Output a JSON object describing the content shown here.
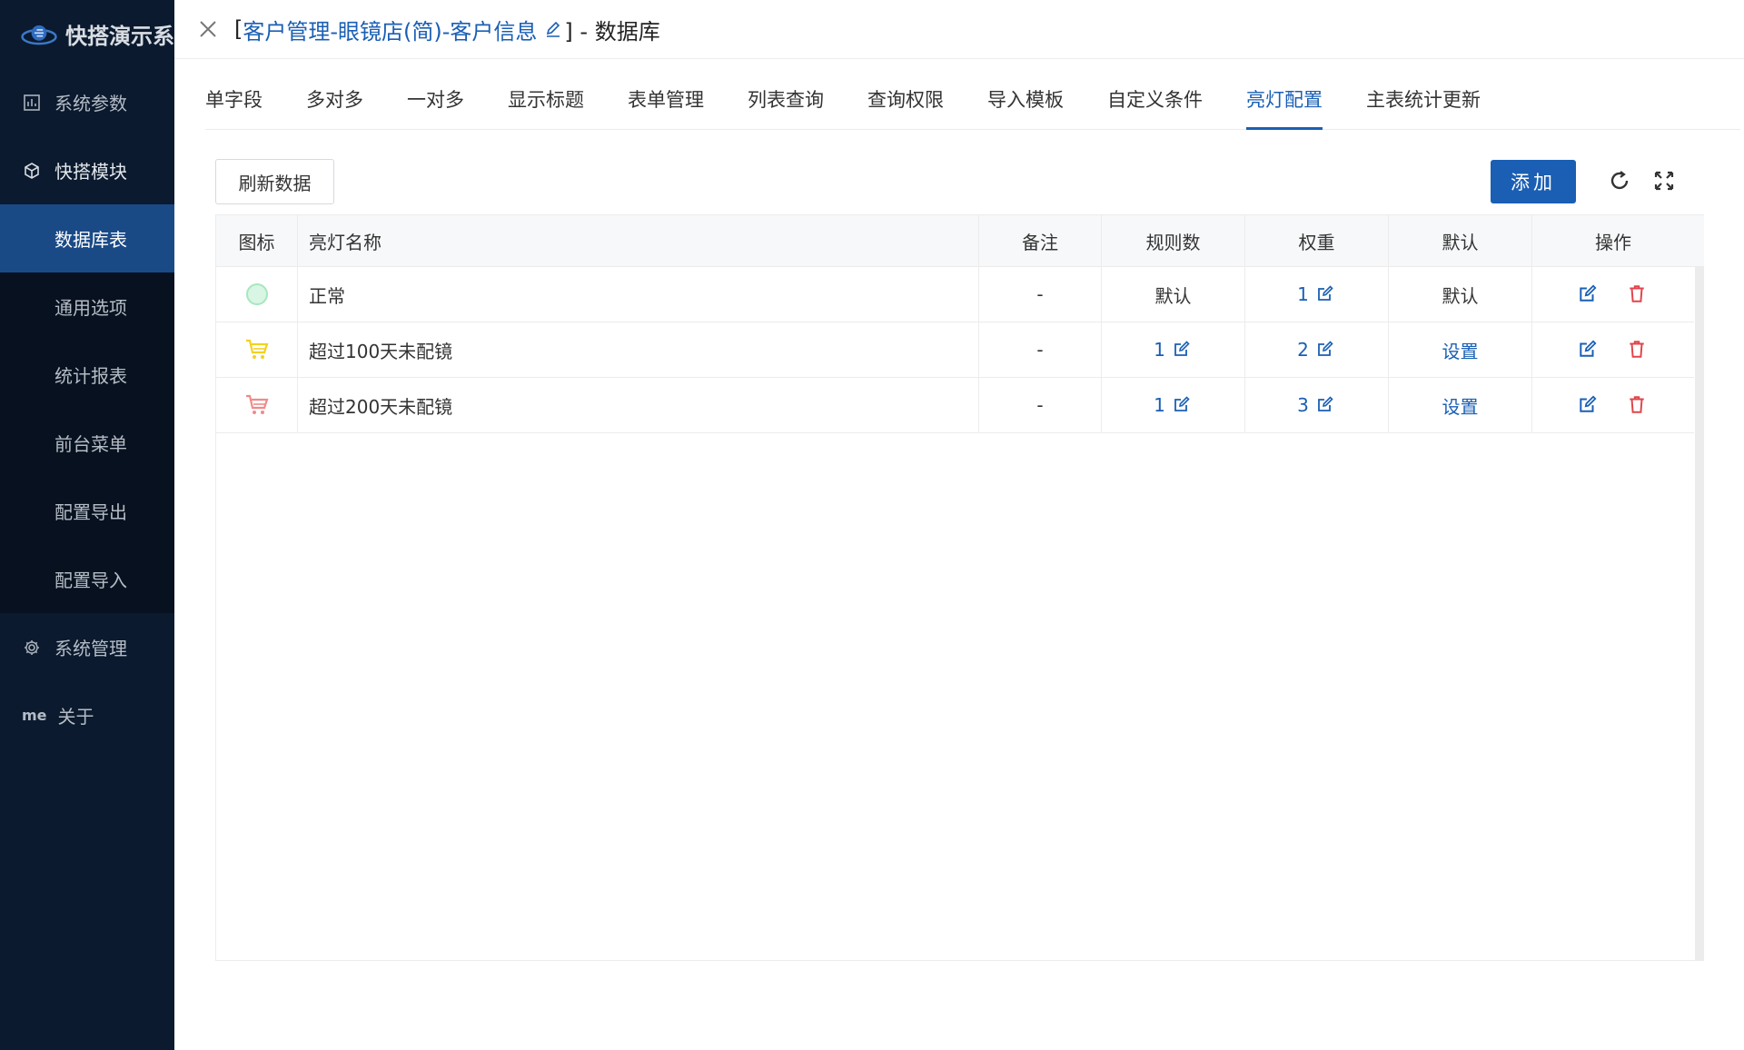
{
  "app": {
    "name": "快搭演示系"
  },
  "sidebar": {
    "items": [
      {
        "label": "系统参数",
        "icon": "chart-box-icon"
      },
      {
        "label": "快搭模块",
        "icon": "cube-icon"
      },
      {
        "label": "数据库表"
      },
      {
        "label": "通用选项"
      },
      {
        "label": "统计报表"
      },
      {
        "label": "前台菜单"
      },
      {
        "label": "配置导出"
      },
      {
        "label": "配置导入"
      },
      {
        "label": "系统管理",
        "icon": "gear-icon"
      },
      {
        "label": "关于",
        "tag": "me"
      }
    ]
  },
  "header": {
    "bracket_open": "[",
    "title_link": "客户管理-眼镜店(简)-客户信息",
    "title_suffix": "] - 数据库"
  },
  "tabs": [
    {
      "label": "单字段"
    },
    {
      "label": "多对多"
    },
    {
      "label": "一对多"
    },
    {
      "label": "显示标题"
    },
    {
      "label": "表单管理"
    },
    {
      "label": "列表查询"
    },
    {
      "label": "查询权限"
    },
    {
      "label": "导入模板"
    },
    {
      "label": "自定义条件"
    },
    {
      "label": "亮灯配置",
      "active": true
    },
    {
      "label": "主表统计更新"
    }
  ],
  "toolbar": {
    "refresh_label": "刷新数据",
    "add_label": "添加"
  },
  "table": {
    "headers": {
      "icon": "图标",
      "name": "亮灯名称",
      "note": "备注",
      "rules": "规则数",
      "weight": "权重",
      "default": "默认",
      "ops": "操作"
    },
    "rows": [
      {
        "icon": "green-circle-icon",
        "name": "正常",
        "note": "-",
        "rules": "默认",
        "weight": "1",
        "default": "默认"
      },
      {
        "icon": "yellow-cart-icon",
        "name": "超过100天未配镜",
        "note": "-",
        "rules": "1",
        "weight": "2",
        "default": "设置"
      },
      {
        "icon": "red-cart-icon",
        "name": "超过200天未配镜",
        "note": "-",
        "rules": "1",
        "weight": "3",
        "default": "设置"
      }
    ]
  },
  "colors": {
    "accent": "#1a5fb4",
    "sidebar_bg": "#0b1a2e",
    "active_menu": "#1a4a86",
    "delete": "#e0454b",
    "green_light": "#a6e7bf",
    "yellow_cart": "#f2d21f",
    "red_cart": "#f08a8a"
  }
}
